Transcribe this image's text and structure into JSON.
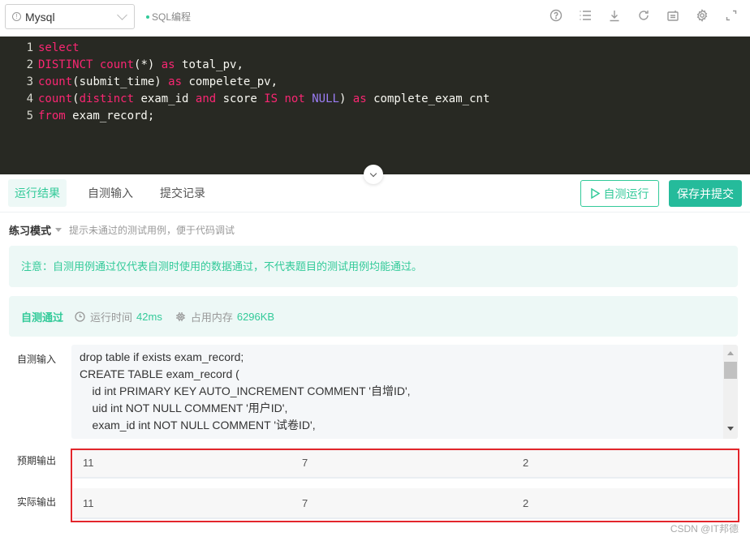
{
  "header": {
    "language": "Mysql",
    "mode_tag": "SQL编程",
    "toolbar_icons": [
      "help-icon",
      "list-icon",
      "download-icon",
      "refresh-icon",
      "keyboard-icon",
      "settings-icon",
      "fullscreen-icon"
    ]
  },
  "editor": {
    "lines": [
      {
        "n": "1",
        "tokens": [
          {
            "t": "select",
            "c": "kw"
          }
        ]
      },
      {
        "n": "2",
        "tokens": [
          {
            "t": "DISTINCT count",
            "c": "kw"
          },
          {
            "t": "(*) ",
            "c": ""
          },
          {
            "t": "as",
            "c": "kw"
          },
          {
            "t": " total_pv,",
            "c": ""
          }
        ]
      },
      {
        "n": "3",
        "tokens": [
          {
            "t": "count",
            "c": "kw"
          },
          {
            "t": "(submit_time) ",
            "c": ""
          },
          {
            "t": "as",
            "c": "kw"
          },
          {
            "t": " compelete_pv,",
            "c": ""
          }
        ]
      },
      {
        "n": "4",
        "tokens": [
          {
            "t": "count",
            "c": "kw"
          },
          {
            "t": "(",
            "c": ""
          },
          {
            "t": "distinct",
            "c": "kw"
          },
          {
            "t": " exam_id ",
            "c": ""
          },
          {
            "t": "and",
            "c": "kw"
          },
          {
            "t": " score ",
            "c": ""
          },
          {
            "t": "IS not",
            "c": "kw"
          },
          {
            "t": " ",
            "c": ""
          },
          {
            "t": "NULL",
            "c": "nl"
          },
          {
            "t": ") ",
            "c": ""
          },
          {
            "t": "as",
            "c": "kw"
          },
          {
            "t": " complete_exam_cnt",
            "c": ""
          }
        ]
      },
      {
        "n": "5",
        "tokens": [
          {
            "t": "from",
            "c": "kw"
          },
          {
            "t": " exam_record;",
            "c": ""
          }
        ]
      }
    ]
  },
  "tabs": [
    {
      "label": "运行结果",
      "active": true
    },
    {
      "label": "自测输入",
      "active": false
    },
    {
      "label": "提交记录",
      "active": false
    }
  ],
  "actions": {
    "run_label": "自测运行",
    "submit_label": "保存并提交"
  },
  "practice": {
    "mode_label": "练习模式",
    "hint": "提示未通过的测试用例，便于代码调试"
  },
  "notice": "注意：自测用例通过仅代表自测时使用的数据通过，不代表题目的测试用例均能通过。",
  "status": {
    "result": "自测通过",
    "runtime_label": "运行时间",
    "runtime_value": "42ms",
    "memory_label": "占用内存",
    "memory_value": "6296KB"
  },
  "self_input": {
    "label": "自测输入",
    "text": "drop table if exists exam_record;\nCREATE TABLE exam_record (\n    id int PRIMARY KEY AUTO_INCREMENT COMMENT '自增ID',\n    uid int NOT NULL COMMENT '用户ID',\n    exam_id int NOT NULL COMMENT '试卷ID',"
  },
  "expected_output": {
    "label": "预期输出",
    "values": [
      "11",
      "7",
      "2"
    ]
  },
  "actual_output": {
    "label": "实际输出",
    "values": [
      "11",
      "7",
      "2"
    ]
  },
  "watermark": "CSDN @IT邦德",
  "colors": {
    "accent": "#32ca99",
    "submit_bg": "#25bb9b",
    "editor_bg": "#282923",
    "keyword": "#f92672",
    "null_literal": "#9b7df5",
    "highlight_frame": "#e3262c"
  }
}
